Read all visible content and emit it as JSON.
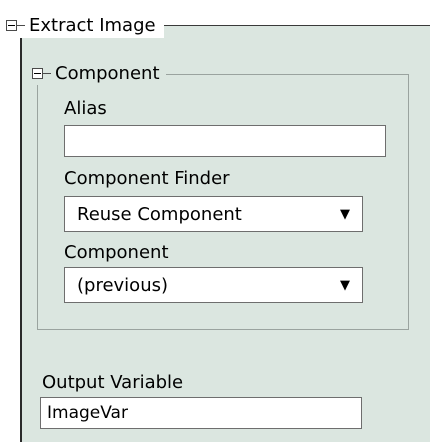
{
  "extract_image": {
    "title": "Extract Image",
    "component_group": {
      "title": "Component",
      "alias": {
        "label": "Alias",
        "value": ""
      },
      "component_finder": {
        "label": "Component Finder",
        "selected": "Reuse Component"
      },
      "component": {
        "label": "Component",
        "selected": "(previous)"
      }
    },
    "output_variable": {
      "label": "Output Variable",
      "value": "ImageVar"
    }
  },
  "icons": {
    "expander": "minus-box-icon",
    "dropdown": "triangle-down-icon"
  }
}
